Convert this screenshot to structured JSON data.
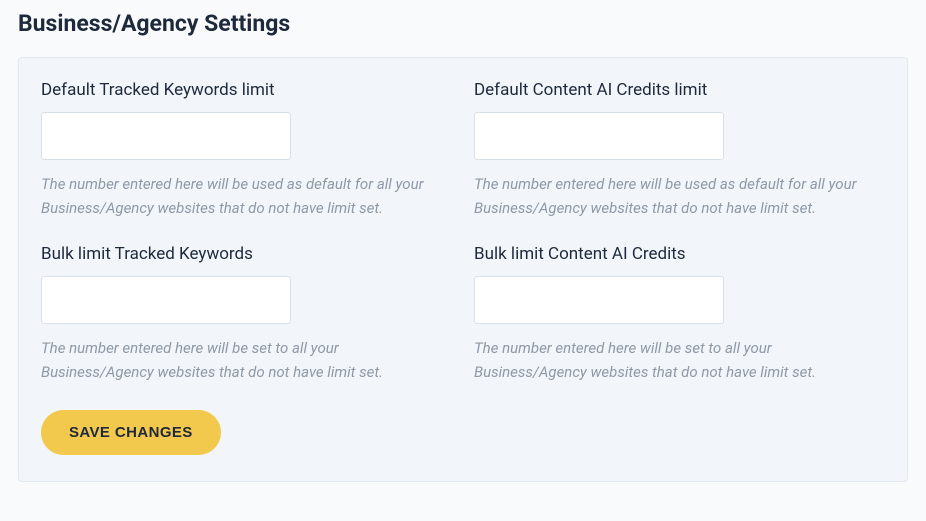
{
  "title": "Business/Agency Settings",
  "fields": {
    "default_tracked_keywords": {
      "label": "Default Tracked Keywords limit",
      "value": "",
      "help": "The number entered here will be used as default for all your Business/Agency websites that do not have limit set."
    },
    "default_content_ai_credits": {
      "label": "Default Content AI Credits limit",
      "value": "",
      "help": "The number entered here will be used as default for all your Business/Agency websites that do not have limit set."
    },
    "bulk_tracked_keywords": {
      "label": "Bulk limit Tracked Keywords",
      "value": "",
      "help": "The number entered here will be set to all your Business/Agency websites that do not have limit set."
    },
    "bulk_content_ai_credits": {
      "label": "Bulk limit Content AI Credits",
      "value": "",
      "help": "The number entered here will be set to all your Business/Agency websites that do not have limit set."
    }
  },
  "actions": {
    "save_label": "SAVE CHANGES"
  },
  "colors": {
    "accent": "#f2c94c",
    "text": "#1e293b",
    "muted": "#8e98a6",
    "panel_bg": "#f2f6fa",
    "border": "#e2e8f0"
  }
}
